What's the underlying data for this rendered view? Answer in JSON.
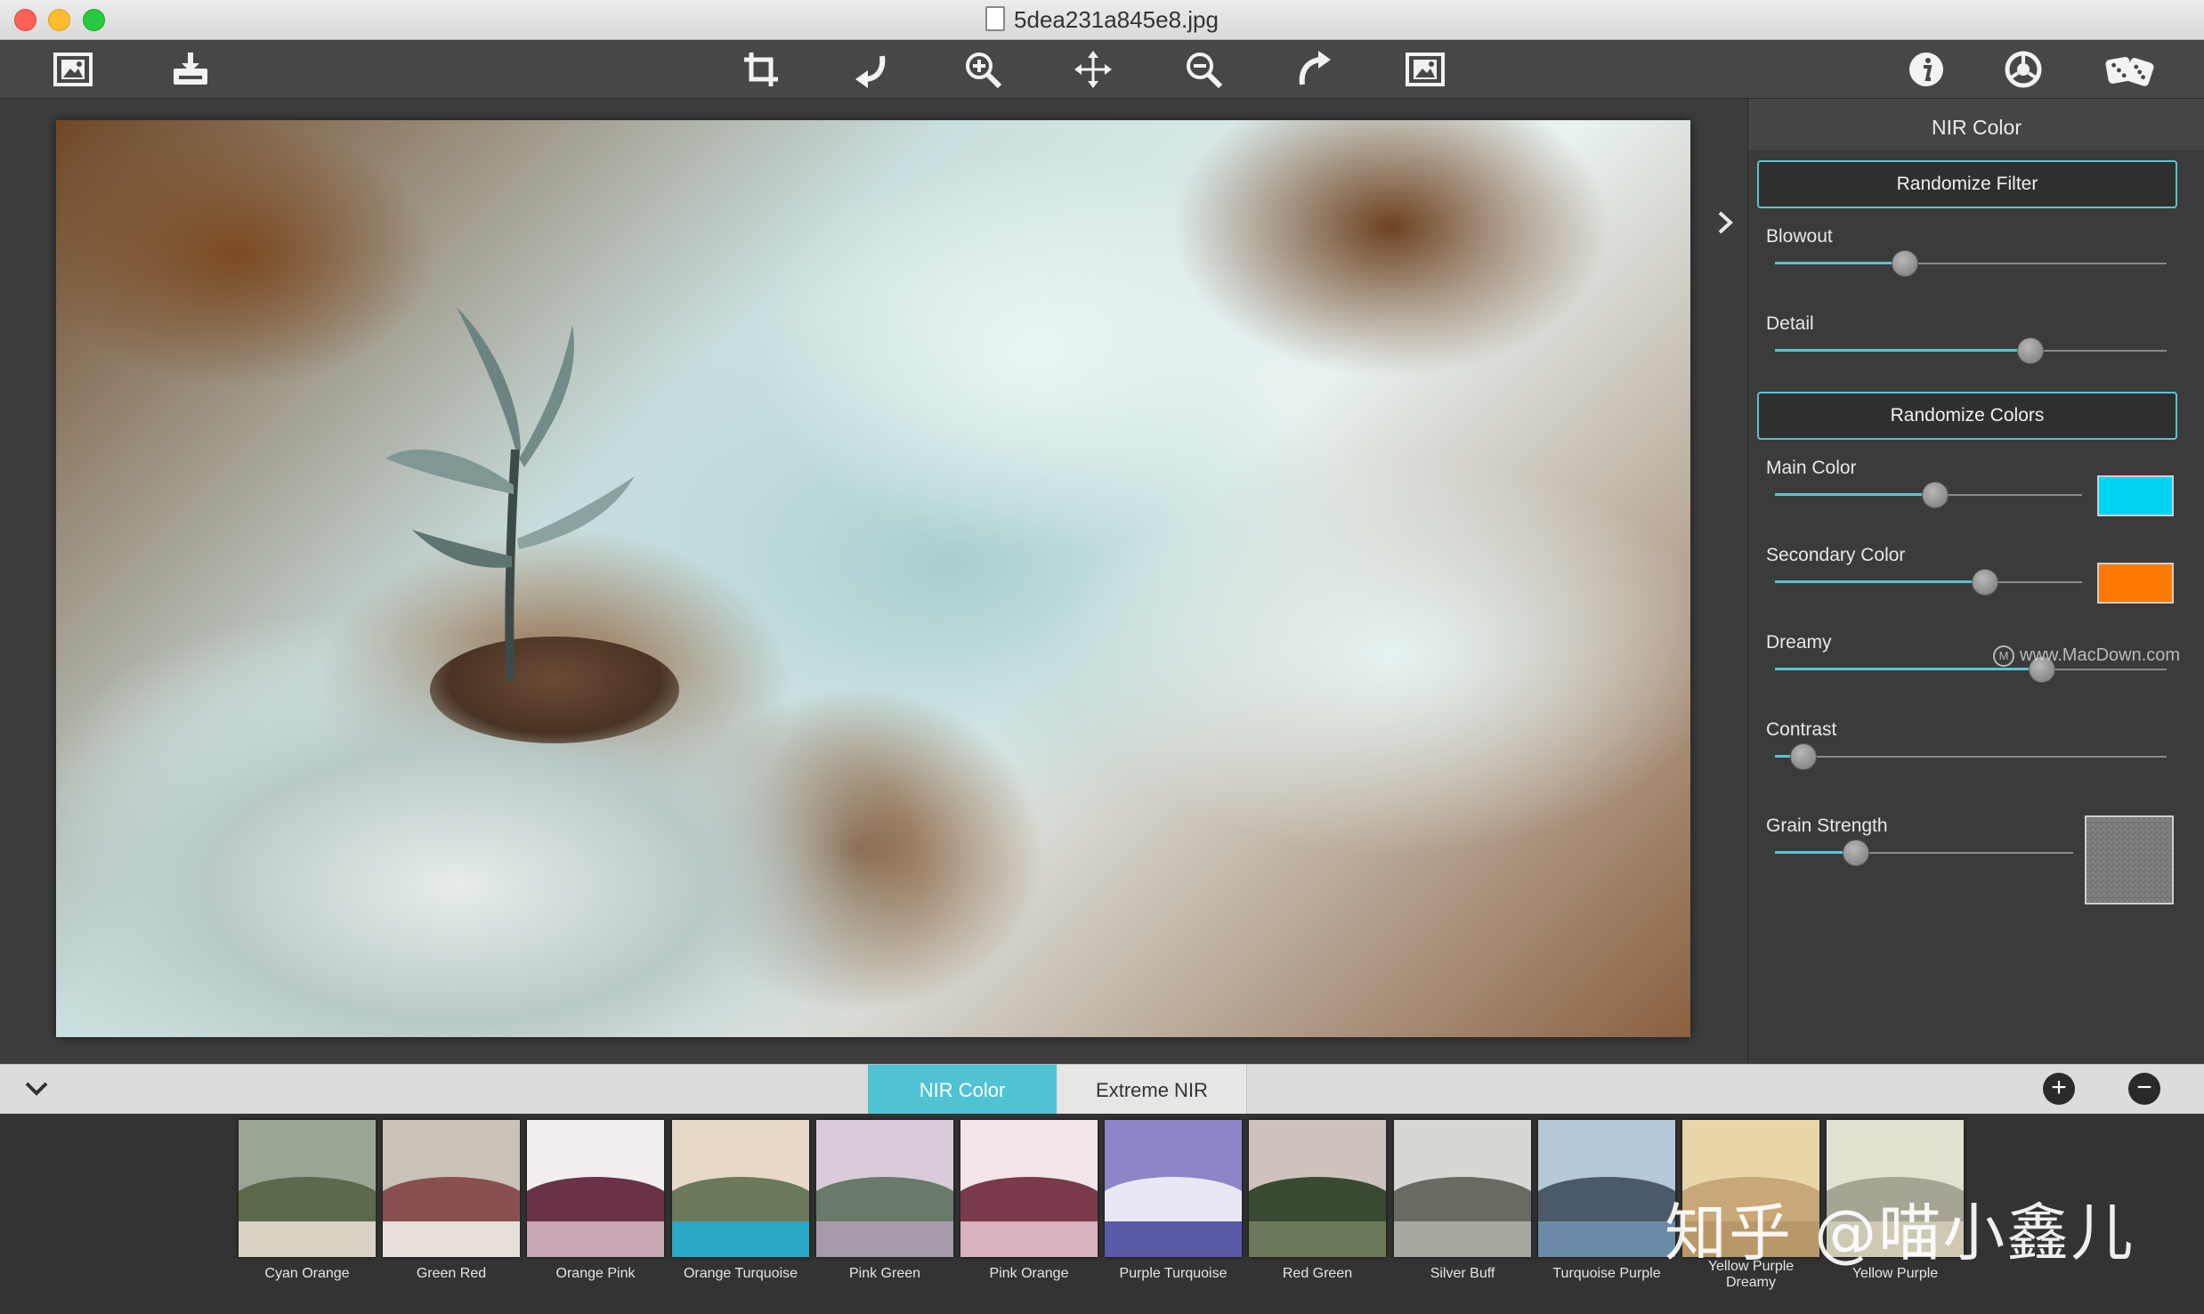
{
  "window": {
    "title": "5dea231a845e8.jpg"
  },
  "toolbar": {
    "icons": [
      "open-image-icon",
      "save-export-icon",
      "crop-icon",
      "undo-icon",
      "zoom-in-icon",
      "move-icon",
      "zoom-out-icon",
      "redo-icon",
      "compare-icon",
      "info-icon",
      "settings-icon",
      "randomize-dice-icon"
    ]
  },
  "panel": {
    "title": "NIR Color",
    "randomize_filter": "Randomize Filter",
    "randomize_colors": "Randomize Colors",
    "sliders": {
      "blowout": {
        "label": "Blowout",
        "value": 0.33
      },
      "detail": {
        "label": "Detail",
        "value": 0.65
      },
      "main_color": {
        "label": "Main Color",
        "value": 0.52
      },
      "secondary_color": {
        "label": "Secondary Color",
        "value": 0.68
      },
      "dreamy": {
        "label": "Dreamy",
        "value": 0.68
      },
      "contrast": {
        "label": "Contrast",
        "value": 0.07
      },
      "grain_strength": {
        "label": "Grain Strength",
        "value": 0.27
      }
    },
    "colors": {
      "main": "#00d4f5",
      "secondary": "#ff7a00",
      "accent": "#5cc3d2"
    },
    "watermark": "www.MacDown.com"
  },
  "tabs": [
    {
      "label": "NIR Color",
      "active": true
    },
    {
      "label": "Extreme NIR",
      "active": false
    }
  ],
  "presets": [
    {
      "name": "Cyan Orange",
      "sky": "#9aa694",
      "hill": "#5a6a4a",
      "ground": "#d8d2c2"
    },
    {
      "name": "Green Red",
      "sky": "#c9c2b8",
      "hill": "#8a5050",
      "ground": "#e6e0d8"
    },
    {
      "name": "Orange Pink",
      "sky": "#f2eeee",
      "hill": "#6a3248",
      "ground": "#c7a6b6"
    },
    {
      "name": "Orange Turquoise",
      "sky": "#e8d8c8",
      "hill": "#6a7a5a",
      "ground": "#2aa8c6"
    },
    {
      "name": "Pink Green",
      "sky": "#d9cbd9",
      "hill": "#6a7a6a",
      "ground": "#a69aaa"
    },
    {
      "name": "Pink Orange",
      "sky": "#f2e6ea",
      "hill": "#7a3a4a",
      "ground": "#d8b2bc"
    },
    {
      "name": "Purple Turquoise",
      "sky": "#8c86c8",
      "hill": "#e8e8f4",
      "ground": "#5a5aa8"
    },
    {
      "name": "Red Green",
      "sky": "#cfc2bc",
      "hill": "#3a4a32",
      "ground": "#6a7a5a"
    },
    {
      "name": "Silver Buff",
      "sky": "#d6d6d2",
      "hill": "#6a6a62",
      "ground": "#a8a8a0"
    },
    {
      "name": "Turquoise Purple",
      "sky": "#b4c8d8",
      "hill": "#4a5a6a",
      "ground": "#6a8aa8"
    },
    {
      "name": "Yellow Purple Dreamy",
      "sky": "#e8d6a8",
      "hill": "#c8a878",
      "ground": "#b89868"
    },
    {
      "name": "Yellow Purple",
      "sky": "#e4e0d0",
      "hill": "#a8a494",
      "ground": "#cfc9b4"
    }
  ],
  "overlay_watermark": "知乎 @喵小鑫儿"
}
